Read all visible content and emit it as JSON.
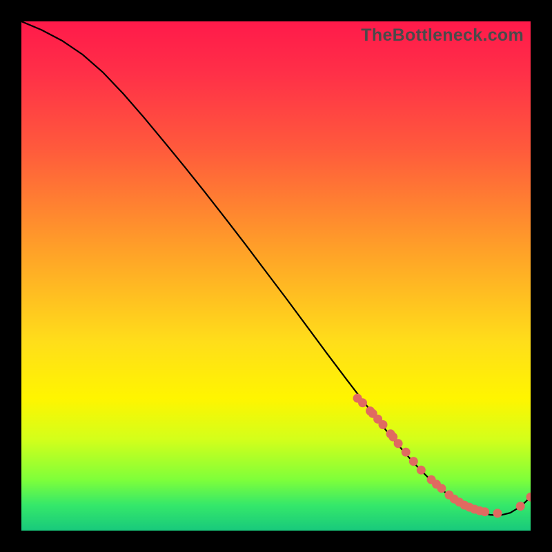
{
  "watermark": "TheBottleneck.com",
  "chart_data": {
    "type": "line",
    "title": "",
    "xlabel": "",
    "ylabel": "",
    "xlim": [
      0,
      100
    ],
    "ylim": [
      0,
      100
    ],
    "series": [
      {
        "name": "curve",
        "x": [
          0,
          4,
          8,
          12,
          16,
          20,
          24,
          28,
          32,
          36,
          40,
          44,
          48,
          52,
          56,
          60,
          64,
          68,
          72,
          74,
          76,
          78,
          80,
          82,
          84,
          86,
          88,
          90,
          92,
          94,
          96,
          98,
          100
        ],
        "y": [
          100,
          98.3,
          96.2,
          93.5,
          90.0,
          85.8,
          81.2,
          76.4,
          71.5,
          66.5,
          61.4,
          56.2,
          50.9,
          45.6,
          40.2,
          34.8,
          29.5,
          24.3,
          19.2,
          16.8,
          14.5,
          12.3,
          10.3,
          8.5,
          6.9,
          5.5,
          4.4,
          3.6,
          3.1,
          3.0,
          3.5,
          4.7,
          6.6
        ]
      },
      {
        "name": "dots",
        "x": [
          66,
          67,
          68.5,
          69,
          70,
          71,
          72.5,
          73,
          74,
          75.5,
          77,
          78.5,
          80.5,
          81.5,
          82.5,
          84,
          85,
          86,
          87,
          88,
          89,
          90,
          91,
          93.5,
          98,
          100
        ],
        "y": [
          26.0,
          25.1,
          23.5,
          23.0,
          21.9,
          20.8,
          19.0,
          18.4,
          17.1,
          15.4,
          13.6,
          11.9,
          10.0,
          9.1,
          8.3,
          7.0,
          6.2,
          5.6,
          5.0,
          4.6,
          4.2,
          3.9,
          3.7,
          3.4,
          4.8,
          6.6
        ]
      }
    ],
    "colors": {
      "curve": "#000000",
      "dots": "#e06a60"
    }
  }
}
